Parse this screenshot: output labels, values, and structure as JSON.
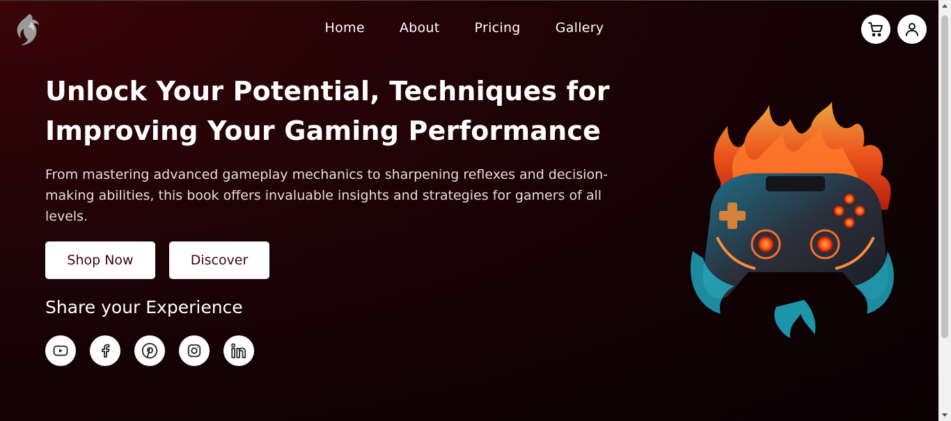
{
  "nav": {
    "items": [
      {
        "label": "Home"
      },
      {
        "label": "About"
      },
      {
        "label": "Pricing"
      },
      {
        "label": "Gallery"
      }
    ]
  },
  "header": {
    "logo_icon": "dragon-logo-icon",
    "cart_icon": "cart-icon",
    "user_icon": "user-icon"
  },
  "hero": {
    "title": "Unlock Your Potential, Techniques for Improving Your Gaming Performance",
    "description": "From mastering advanced gameplay mechanics to sharpening reflexes and decision-making abilities, this book offers invaluable insights and strategies for gamers of all levels.",
    "shop_label": "Shop Now",
    "discover_label": "Discover",
    "image_icon": "flaming-game-controller-image"
  },
  "share": {
    "title": "Share your Experience",
    "icons": [
      "youtube-icon",
      "facebook-icon",
      "pinterest-icon",
      "instagram-icon",
      "linkedin-icon"
    ]
  },
  "colors": {
    "background": "#220306",
    "button_text": "#3a0508",
    "button_bg": "#ffffff"
  }
}
